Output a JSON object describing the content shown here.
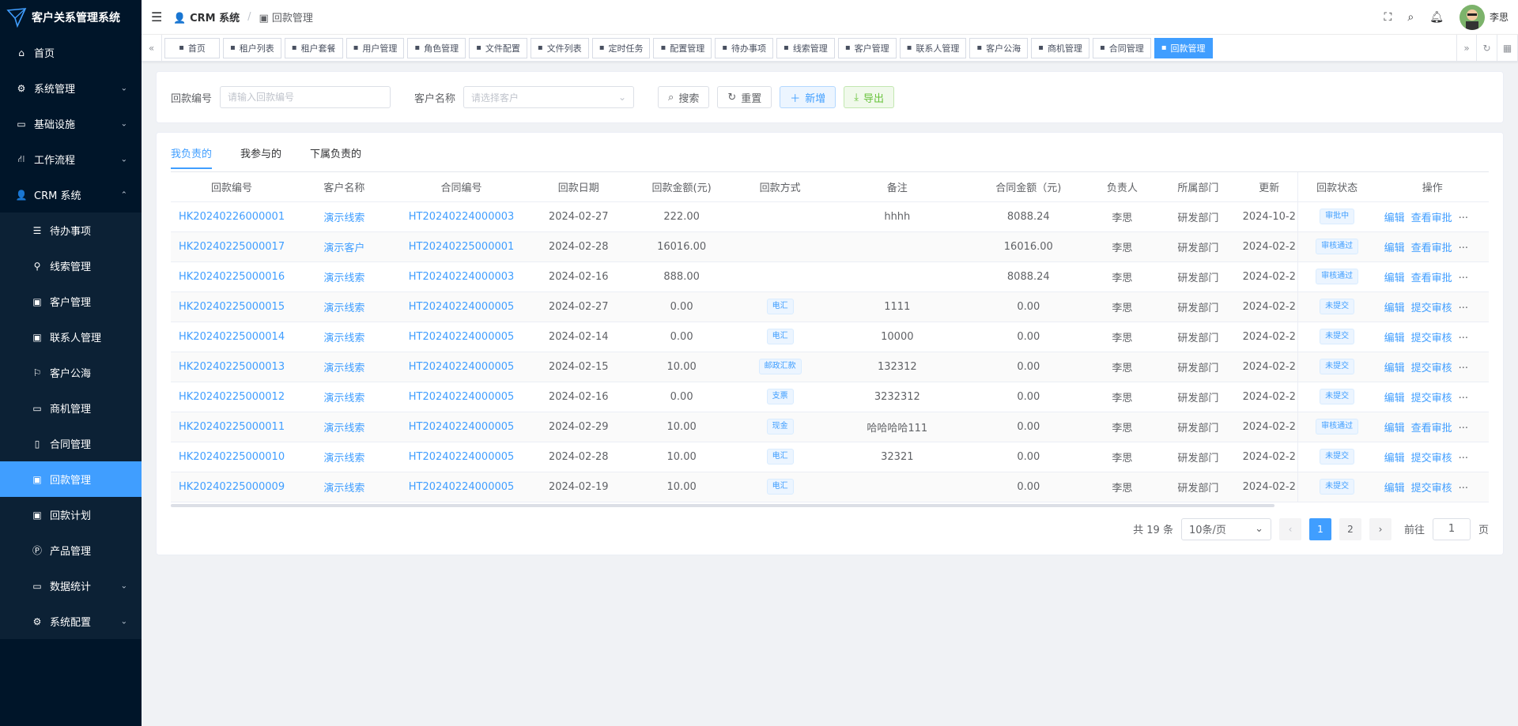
{
  "app": {
    "title": "客户关系管理系统"
  },
  "sidebar": {
    "items": [
      {
        "label": "首页",
        "icon": "home-icon"
      },
      {
        "label": "系统管理",
        "icon": "gear-icon"
      },
      {
        "label": "基础设施",
        "icon": "monitor-icon"
      },
      {
        "label": "工作流程",
        "icon": "workflow-icon"
      },
      {
        "label": "CRM 系统",
        "icon": "user-icon"
      }
    ],
    "crm_children": [
      {
        "label": "待办事项"
      },
      {
        "label": "线索管理"
      },
      {
        "label": "客户管理"
      },
      {
        "label": "联系人管理"
      },
      {
        "label": "客户公海"
      },
      {
        "label": "商机管理"
      },
      {
        "label": "合同管理"
      },
      {
        "label": "回款管理"
      },
      {
        "label": "回款计划"
      },
      {
        "label": "产品管理"
      },
      {
        "label": "数据统计"
      },
      {
        "label": "系统配置"
      }
    ]
  },
  "navbar": {
    "breadcrumb_root": "CRM 系统",
    "breadcrumb_current": "回款管理",
    "user_name": "李思"
  },
  "tags": [
    "首页",
    "租户列表",
    "租户套餐",
    "用户管理",
    "角色管理",
    "文件配置",
    "文件列表",
    "定时任务",
    "配置管理",
    "待办事项",
    "线索管理",
    "客户管理",
    "联系人管理",
    "客户公海",
    "商机管理",
    "合同管理",
    "回款管理"
  ],
  "search": {
    "no_label": "回款编号",
    "no_placeholder": "请输入回款编号",
    "customer_label": "客户名称",
    "customer_placeholder": "请选择客户",
    "search_btn": "搜索",
    "reset_btn": "重置",
    "add_btn": "新增",
    "export_btn": "导出"
  },
  "tabs": [
    "我负责的",
    "我参与的",
    "下属负责的"
  ],
  "table": {
    "headers": [
      "回款编号",
      "客户名称",
      "合同编号",
      "回款日期",
      "回款金额(元)",
      "回款方式",
      "备注",
      "合同金额（元)",
      "负责人",
      "所属部门",
      "更新",
      "回款状态",
      "操作"
    ],
    "rows": [
      {
        "no": "HK20240226000001",
        "customer": "演示线索",
        "contract": "HT20240224000003",
        "date": "2024-02-27",
        "amount": "222.00",
        "method": "",
        "remark": "hhhh",
        "contract_amount": "8088.24",
        "owner": "李思",
        "dept": "研发部门",
        "updated": "2024-10-2",
        "status": "审批中",
        "op1": "编辑",
        "op2": "查看审批",
        "more": "..."
      },
      {
        "no": "HK20240225000017",
        "customer": "演示客户",
        "contract": "HT20240225000001",
        "date": "2024-02-28",
        "amount": "16016.00",
        "method": "",
        "remark": "",
        "contract_amount": "16016.00",
        "owner": "李思",
        "dept": "研发部门",
        "updated": "2024-02-2",
        "status": "审核通过",
        "op1": "编辑",
        "op2": "查看审批",
        "more": "..."
      },
      {
        "no": "HK20240225000016",
        "customer": "演示线索",
        "contract": "HT20240224000003",
        "date": "2024-02-16",
        "amount": "888.00",
        "method": "",
        "remark": "",
        "contract_amount": "8088.24",
        "owner": "李思",
        "dept": "研发部门",
        "updated": "2024-02-2",
        "status": "审核通过",
        "op1": "编辑",
        "op2": "查看审批",
        "more": "..."
      },
      {
        "no": "HK20240225000015",
        "customer": "演示线索",
        "contract": "HT20240224000005",
        "date": "2024-02-27",
        "amount": "0.00",
        "method": "电汇",
        "remark": "1111",
        "contract_amount": "0.00",
        "owner": "李思",
        "dept": "研发部门",
        "updated": "2024-02-2",
        "status": "未提交",
        "op1": "编辑",
        "op2": "提交审核",
        "more": "..."
      },
      {
        "no": "HK20240225000014",
        "customer": "演示线索",
        "contract": "HT20240224000005",
        "date": "2024-02-14",
        "amount": "0.00",
        "method": "电汇",
        "remark": "10000",
        "contract_amount": "0.00",
        "owner": "李思",
        "dept": "研发部门",
        "updated": "2024-02-2",
        "status": "未提交",
        "op1": "编辑",
        "op2": "提交审核",
        "more": "..."
      },
      {
        "no": "HK20240225000013",
        "customer": "演示线索",
        "contract": "HT20240224000005",
        "date": "2024-02-15",
        "amount": "10.00",
        "method": "邮政汇款",
        "remark": "132312",
        "contract_amount": "0.00",
        "owner": "李思",
        "dept": "研发部门",
        "updated": "2024-02-2",
        "status": "未提交",
        "op1": "编辑",
        "op2": "提交审核",
        "more": "..."
      },
      {
        "no": "HK20240225000012",
        "customer": "演示线索",
        "contract": "HT20240224000005",
        "date": "2024-02-16",
        "amount": "0.00",
        "method": "支票",
        "remark": "3232312",
        "contract_amount": "0.00",
        "owner": "李思",
        "dept": "研发部门",
        "updated": "2024-02-2",
        "status": "未提交",
        "op1": "编辑",
        "op2": "提交审核",
        "more": "..."
      },
      {
        "no": "HK20240225000011",
        "customer": "演示线索",
        "contract": "HT20240224000005",
        "date": "2024-02-29",
        "amount": "10.00",
        "method": "现金",
        "remark": "哈哈哈哈111",
        "contract_amount": "0.00",
        "owner": "李思",
        "dept": "研发部门",
        "updated": "2024-02-2",
        "status": "审核通过",
        "op1": "编辑",
        "op2": "查看审批",
        "more": "..."
      },
      {
        "no": "HK20240225000010",
        "customer": "演示线索",
        "contract": "HT20240224000005",
        "date": "2024-02-28",
        "amount": "10.00",
        "method": "电汇",
        "remark": "32321",
        "contract_amount": "0.00",
        "owner": "李思",
        "dept": "研发部门",
        "updated": "2024-02-2",
        "status": "未提交",
        "op1": "编辑",
        "op2": "提交审核",
        "more": "..."
      },
      {
        "no": "HK20240225000009",
        "customer": "演示线索",
        "contract": "HT20240224000005",
        "date": "2024-02-19",
        "amount": "10.00",
        "method": "电汇",
        "remark": "",
        "contract_amount": "0.00",
        "owner": "李思",
        "dept": "研发部门",
        "updated": "2024-02-2",
        "status": "未提交",
        "op1": "编辑",
        "op2": "提交审核",
        "more": "..."
      }
    ]
  },
  "pager": {
    "total": "共 19 条",
    "size": "10条/页",
    "page1": "1",
    "page2": "2",
    "goto": "前往",
    "goto_value": "1",
    "page_unit": "页"
  },
  "colors": {
    "sidebar": "#001529",
    "accent": "#409eff",
    "success": "#67c23a"
  }
}
